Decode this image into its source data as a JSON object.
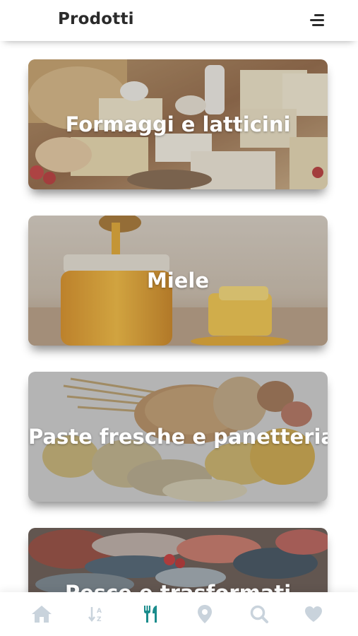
{
  "header": {
    "title": "Prodotti"
  },
  "categories": [
    {
      "label": "Formaggi e latticini",
      "image": "cheese-and-dairy-photo"
    },
    {
      "label": "Miele",
      "image": "honey-jar-photo"
    },
    {
      "label": "Paste fresche e panetteria",
      "image": "bread-and-pasta-photo"
    },
    {
      "label": "Pesce e trasformati",
      "image": "fish-photo"
    }
  ],
  "nav": {
    "items": [
      {
        "icon": "home-icon",
        "active": false
      },
      {
        "icon": "sort-icon",
        "active": false
      },
      {
        "icon": "utensils-icon",
        "active": true
      },
      {
        "icon": "map-pin-icon",
        "active": false
      },
      {
        "icon": "search-icon",
        "active": false
      },
      {
        "icon": "heart-icon",
        "active": false
      }
    ],
    "active_color": "#1a8c8c",
    "inactive_color": "#c9d3dc"
  }
}
